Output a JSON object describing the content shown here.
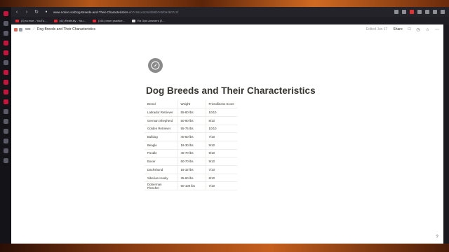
{
  "browser": {
    "url_host": "www.notion.so",
    "url_rest": "/Dog-Breeds-and-Their-Characteristics-",
    "url_hash": "eb7c8a1e2c9d4f68b7e5f0a2b07c1f",
    "bookmarks": [
      {
        "label": "(3) ra moe - YouTu..."
      },
      {
        "label": "(41) Redbully - You..."
      },
      {
        "label": "(161) drum practice..."
      },
      {
        "label": "Ra Opic Answers (2..."
      }
    ]
  },
  "notion": {
    "breadcrumb_workspace": "xxx",
    "breadcrumb_page": "Dog Breeds and Their Characteristics",
    "edited": "Edited Jun 17",
    "share_label": "Share",
    "page_title": "Dog Breeds and Their Characteristics",
    "help_label": "?"
  },
  "table": {
    "headers": [
      "Breed",
      "Weight",
      "Friendliness Score"
    ],
    "rows": [
      [
        "Labrador Retriever",
        "55-80 lbs",
        "10/10"
      ],
      [
        "German Shepherd",
        "50-90 lbs",
        "8/10"
      ],
      [
        "Golden Retriever",
        "55-75 lbs",
        "10/10"
      ],
      [
        "Bulldog",
        "40-50 lbs",
        "7/10"
      ],
      [
        "Beagle",
        "18-30 lbs",
        "9/10"
      ],
      [
        "Poodle",
        "40-70 lbs",
        "9/10"
      ],
      [
        "Boxer",
        "50-70 lbs",
        "9/10"
      ],
      [
        "Dachshund",
        "16-32 lbs",
        "7/10"
      ],
      [
        "Siberian Husky",
        "35-60 lbs",
        "8/10"
      ],
      [
        "Doberman Pinscher",
        "60-100 lbs",
        "7/10"
      ]
    ]
  },
  "icons": {
    "page_icon": "compass-icon"
  }
}
